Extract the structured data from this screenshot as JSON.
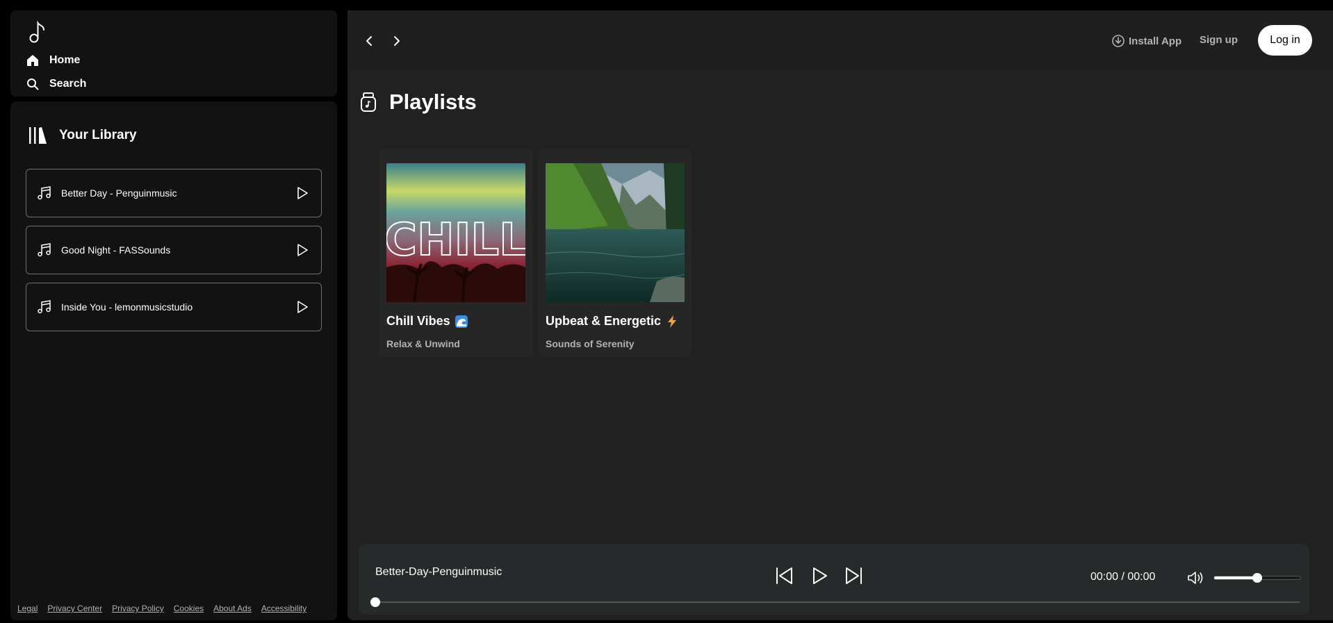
{
  "nav": {
    "home_label": "Home",
    "search_label": "Search"
  },
  "library": {
    "title": "Your Library",
    "tracks": [
      {
        "label": "Better Day - Penguinmusic"
      },
      {
        "label": "Good Night - FASSounds"
      },
      {
        "label": "Inside You - lemonmusicstudio"
      }
    ]
  },
  "footer": {
    "links": [
      "Legal",
      "Privacy Center",
      "Privacy Policy",
      "Cookies",
      "About Ads",
      "Accessibility"
    ]
  },
  "topbar": {
    "install_label": "Install App",
    "signup_label": "Sign up",
    "login_label": "Log in"
  },
  "main": {
    "section_title": "Playlists",
    "playlists": [
      {
        "title": "Chill Vibes",
        "subtitle": "Relax & Unwind",
        "emoji_icon": "wave-icon",
        "art_text": "CHILL"
      },
      {
        "title": "Upbeat & Energetic",
        "subtitle": "Sounds of Serenity",
        "emoji_icon": "lightning-icon"
      }
    ]
  },
  "player": {
    "now_playing": "Better-Day-Penguinmusic",
    "time_display": "00:00 / 00:00",
    "volume_level": 0.5,
    "progress": 0.0
  },
  "colors": {
    "background": "#000000",
    "panel": "#121212",
    "main": "#212121",
    "player": "#262a2a",
    "accent": "#ffffff",
    "muted_text": "#b3b3b3"
  }
}
